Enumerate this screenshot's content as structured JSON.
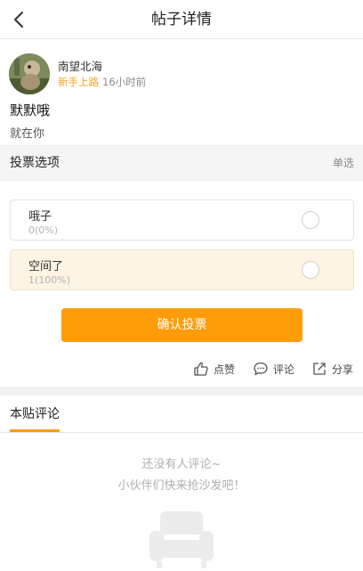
{
  "header": {
    "title": "帖子详情"
  },
  "post": {
    "author": "南望北海",
    "level": "新手上路",
    "time": "16小时前",
    "title": "默默哦",
    "body": "就在你"
  },
  "vote": {
    "section_title": "投票选项",
    "type": "单选",
    "options": [
      {
        "label": "哦子",
        "count": "0(0%)",
        "percent": 0,
        "selected": false
      },
      {
        "label": "空间了",
        "count": "1(100%)",
        "percent": 100,
        "selected": true
      }
    ],
    "confirm_label": "确认投票"
  },
  "actions": {
    "like": "点赞",
    "comment": "评论",
    "share": "分享"
  },
  "comments": {
    "tab_label": "本贴评论",
    "empty_line1": "还没有人评论~",
    "empty_line2": "小伙伴们快来抢沙发吧！"
  },
  "colors": {
    "accent": "#ff9c0a",
    "level": "#f5a623",
    "selected_bg": "#fdf4e3"
  }
}
